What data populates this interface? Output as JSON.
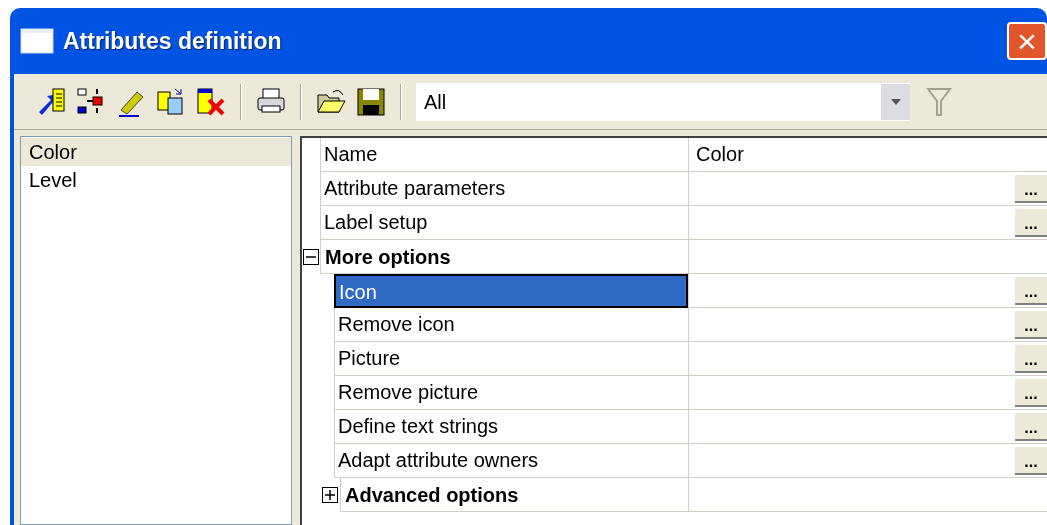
{
  "window": {
    "title": "Attributes definition",
    "close": "×"
  },
  "toolbar": {
    "filter": {
      "value": "All"
    }
  },
  "list": {
    "items": [
      {
        "label": "Color",
        "selected": true
      },
      {
        "label": "Level",
        "selected": false
      }
    ]
  },
  "properties": {
    "rows": [
      {
        "kind": "property",
        "name": "Name",
        "value": "Color",
        "selected": false
      },
      {
        "kind": "property",
        "name": "Attribute parameters",
        "button": "...",
        "selected": false
      },
      {
        "kind": "property",
        "name": "Label setup",
        "button": "...",
        "selected": false
      },
      {
        "kind": "category",
        "name": "More options",
        "expanded": true,
        "children": [
          {
            "kind": "property",
            "name": "Icon",
            "button": "...",
            "selected": true
          },
          {
            "kind": "property",
            "name": "Remove icon",
            "button": "...",
            "selected": false
          },
          {
            "kind": "property",
            "name": "Picture",
            "button": "...",
            "selected": false
          },
          {
            "kind": "property",
            "name": "Remove picture",
            "button": "...",
            "selected": false
          },
          {
            "kind": "property",
            "name": "Define text strings",
            "button": "...",
            "selected": false
          },
          {
            "kind": "property",
            "name": "Adapt attribute owners",
            "button": "...",
            "selected": false
          }
        ]
      },
      {
        "kind": "category",
        "name": "Advanced options",
        "expanded": false
      }
    ]
  }
}
